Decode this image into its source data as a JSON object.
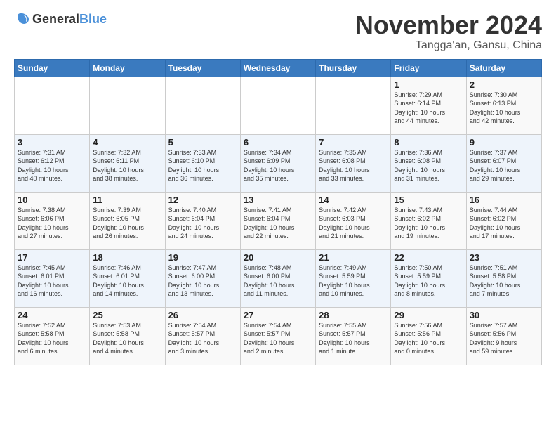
{
  "header": {
    "logo_general": "General",
    "logo_blue": "Blue",
    "month_title": "November 2024",
    "subtitle": "Tangga'an, Gansu, China"
  },
  "weekdays": [
    "Sunday",
    "Monday",
    "Tuesday",
    "Wednesday",
    "Thursday",
    "Friday",
    "Saturday"
  ],
  "weeks": [
    [
      {
        "day": "",
        "info": ""
      },
      {
        "day": "",
        "info": ""
      },
      {
        "day": "",
        "info": ""
      },
      {
        "day": "",
        "info": ""
      },
      {
        "day": "",
        "info": ""
      },
      {
        "day": "1",
        "info": "Sunrise: 7:29 AM\nSunset: 6:14 PM\nDaylight: 10 hours\nand 44 minutes."
      },
      {
        "day": "2",
        "info": "Sunrise: 7:30 AM\nSunset: 6:13 PM\nDaylight: 10 hours\nand 42 minutes."
      }
    ],
    [
      {
        "day": "3",
        "info": "Sunrise: 7:31 AM\nSunset: 6:12 PM\nDaylight: 10 hours\nand 40 minutes."
      },
      {
        "day": "4",
        "info": "Sunrise: 7:32 AM\nSunset: 6:11 PM\nDaylight: 10 hours\nand 38 minutes."
      },
      {
        "day": "5",
        "info": "Sunrise: 7:33 AM\nSunset: 6:10 PM\nDaylight: 10 hours\nand 36 minutes."
      },
      {
        "day": "6",
        "info": "Sunrise: 7:34 AM\nSunset: 6:09 PM\nDaylight: 10 hours\nand 35 minutes."
      },
      {
        "day": "7",
        "info": "Sunrise: 7:35 AM\nSunset: 6:08 PM\nDaylight: 10 hours\nand 33 minutes."
      },
      {
        "day": "8",
        "info": "Sunrise: 7:36 AM\nSunset: 6:08 PM\nDaylight: 10 hours\nand 31 minutes."
      },
      {
        "day": "9",
        "info": "Sunrise: 7:37 AM\nSunset: 6:07 PM\nDaylight: 10 hours\nand 29 minutes."
      }
    ],
    [
      {
        "day": "10",
        "info": "Sunrise: 7:38 AM\nSunset: 6:06 PM\nDaylight: 10 hours\nand 27 minutes."
      },
      {
        "day": "11",
        "info": "Sunrise: 7:39 AM\nSunset: 6:05 PM\nDaylight: 10 hours\nand 26 minutes."
      },
      {
        "day": "12",
        "info": "Sunrise: 7:40 AM\nSunset: 6:04 PM\nDaylight: 10 hours\nand 24 minutes."
      },
      {
        "day": "13",
        "info": "Sunrise: 7:41 AM\nSunset: 6:04 PM\nDaylight: 10 hours\nand 22 minutes."
      },
      {
        "day": "14",
        "info": "Sunrise: 7:42 AM\nSunset: 6:03 PM\nDaylight: 10 hours\nand 21 minutes."
      },
      {
        "day": "15",
        "info": "Sunrise: 7:43 AM\nSunset: 6:02 PM\nDaylight: 10 hours\nand 19 minutes."
      },
      {
        "day": "16",
        "info": "Sunrise: 7:44 AM\nSunset: 6:02 PM\nDaylight: 10 hours\nand 17 minutes."
      }
    ],
    [
      {
        "day": "17",
        "info": "Sunrise: 7:45 AM\nSunset: 6:01 PM\nDaylight: 10 hours\nand 16 minutes."
      },
      {
        "day": "18",
        "info": "Sunrise: 7:46 AM\nSunset: 6:01 PM\nDaylight: 10 hours\nand 14 minutes."
      },
      {
        "day": "19",
        "info": "Sunrise: 7:47 AM\nSunset: 6:00 PM\nDaylight: 10 hours\nand 13 minutes."
      },
      {
        "day": "20",
        "info": "Sunrise: 7:48 AM\nSunset: 6:00 PM\nDaylight: 10 hours\nand 11 minutes."
      },
      {
        "day": "21",
        "info": "Sunrise: 7:49 AM\nSunset: 5:59 PM\nDaylight: 10 hours\nand 10 minutes."
      },
      {
        "day": "22",
        "info": "Sunrise: 7:50 AM\nSunset: 5:59 PM\nDaylight: 10 hours\nand 8 minutes."
      },
      {
        "day": "23",
        "info": "Sunrise: 7:51 AM\nSunset: 5:58 PM\nDaylight: 10 hours\nand 7 minutes."
      }
    ],
    [
      {
        "day": "24",
        "info": "Sunrise: 7:52 AM\nSunset: 5:58 PM\nDaylight: 10 hours\nand 6 minutes."
      },
      {
        "day": "25",
        "info": "Sunrise: 7:53 AM\nSunset: 5:58 PM\nDaylight: 10 hours\nand 4 minutes."
      },
      {
        "day": "26",
        "info": "Sunrise: 7:54 AM\nSunset: 5:57 PM\nDaylight: 10 hours\nand 3 minutes."
      },
      {
        "day": "27",
        "info": "Sunrise: 7:54 AM\nSunset: 5:57 PM\nDaylight: 10 hours\nand 2 minutes."
      },
      {
        "day": "28",
        "info": "Sunrise: 7:55 AM\nSunset: 5:57 PM\nDaylight: 10 hours\nand 1 minute."
      },
      {
        "day": "29",
        "info": "Sunrise: 7:56 AM\nSunset: 5:56 PM\nDaylight: 10 hours\nand 0 minutes."
      },
      {
        "day": "30",
        "info": "Sunrise: 7:57 AM\nSunset: 5:56 PM\nDaylight: 9 hours\nand 59 minutes."
      }
    ]
  ]
}
